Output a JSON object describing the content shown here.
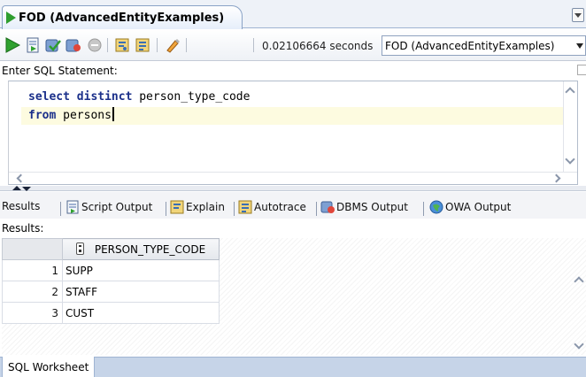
{
  "document_tab": {
    "title": "FOD (AdvancedEntityExamples)"
  },
  "toolbar": {
    "execution_time": "0.02106664 seconds",
    "connection": "FOD (AdvancedEntityExamples)",
    "icons": [
      "run-statement-icon",
      "run-script-icon",
      "commit-icon",
      "rollback-icon",
      "cancel-icon",
      "explain-plan-icon",
      "autotrace-icon",
      "clear-icon"
    ]
  },
  "editor": {
    "label": "Enter SQL Statement:",
    "line1_kw": "select distinct",
    "line1_text": " person_type_code",
    "line2_kw": "from",
    "line2_text": " persons"
  },
  "result_tabs": {
    "results": "Results",
    "script_output": "Script Output",
    "explain": "Explain",
    "autotrace": "Autotrace",
    "dbms_output": "DBMS Output",
    "owa_output": "OWA Output"
  },
  "results": {
    "label": "Results:",
    "column": "PERSON_TYPE_CODE",
    "rows": [
      {
        "n": "1",
        "v": "SUPP"
      },
      {
        "n": "2",
        "v": "STAFF"
      },
      {
        "n": "3",
        "v": "CUST"
      }
    ]
  },
  "bottom_tab": {
    "label": "SQL Worksheet"
  },
  "colors": {
    "keyword": "#1a2f8a",
    "current_line_highlight": "#fdfbe0",
    "tab_bar": "#eef2f8"
  }
}
